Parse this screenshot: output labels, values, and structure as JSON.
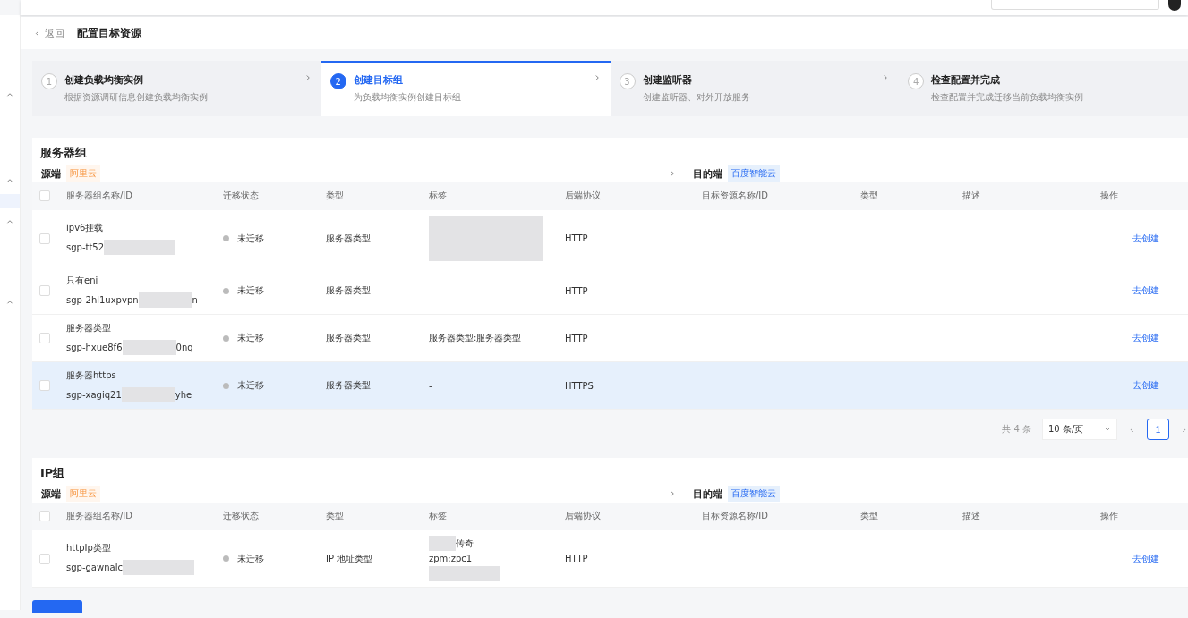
{
  "header": {
    "back": "返回",
    "title": "配置目标资源"
  },
  "steps": [
    {
      "number": "1",
      "title": "创建负载均衡实例",
      "desc": "根据资源调研信息创建负载均衡实例",
      "selected": false
    },
    {
      "number": "2",
      "title": "创建目标组",
      "desc": "为负载均衡实例创建目标组",
      "selected": true
    },
    {
      "number": "3",
      "title": "创建监听器",
      "desc": "创建监听器、对外开放服务",
      "selected": false
    },
    {
      "number": "4",
      "title": "检查配置并完成",
      "desc": "检查配置并完成迁移当前负载均衡实例",
      "selected": false
    }
  ],
  "sections": [
    {
      "title": "服务器组",
      "source_label": "源端",
      "source_tag": "阿里云",
      "target_label": "目的端",
      "target_tag": "百度智能云",
      "all_checked": false,
      "columns": [
        "服务器组名称/ID",
        "迁移状态",
        "类型",
        "标签",
        "后端协议",
        "目标资源名称/ID",
        "类型",
        "描述",
        "操作"
      ],
      "rows": [
        {
          "name": "ipv6挂载",
          "id_start": "sgp-tt52",
          "id_end": "",
          "status": "未迁移",
          "type": "服务器类型",
          "tag_lines": [],
          "tag_redacted": true,
          "protocol": "HTTP",
          "action": "去创建",
          "selected": false
        },
        {
          "name": "只有eni",
          "id_start": "sgp-2hl1uxpvpn",
          "id_end": "n",
          "status": "未迁移",
          "type": "服务器类型",
          "tag_lines": [
            "-"
          ],
          "tag_redacted": false,
          "protocol": "HTTP",
          "action": "去创建",
          "selected": false
        },
        {
          "name": "服务器类型",
          "id_start": "sgp-hxue8f6",
          "id_end": "0nq",
          "status": "未迁移",
          "type": "服务器类型",
          "tag_lines": [
            "服务器类型:服务器类型"
          ],
          "tag_redacted": false,
          "protocol": "HTTP",
          "action": "去创建",
          "selected": false
        },
        {
          "name": "服务器https",
          "id_start": "sgp-xagiq21",
          "id_end": "yhe",
          "status": "未迁移",
          "type": "服务器类型",
          "tag_lines": [
            "-"
          ],
          "tag_redacted": false,
          "protocol": "HTTPS",
          "action": "去创建",
          "selected": true
        }
      ],
      "pagination": {
        "total": "共 4 条",
        "page_size": "10 条/页",
        "pages": [
          {
            "label": "1",
            "selected": true
          }
        ]
      }
    },
    {
      "title": "IP组",
      "source_label": "源端",
      "source_tag": "阿里云",
      "target_label": "目的端",
      "target_tag": "百度智能云",
      "all_checked": false,
      "columns": [
        "服务器组名称/ID",
        "迁移状态",
        "类型",
        "标签",
        "后端协议",
        "目标资源名称/ID",
        "类型",
        "描述",
        "操作"
      ],
      "rows": [
        {
          "name": "httpIp类型",
          "id_start": "sgp-gawnalc",
          "id_end": "",
          "status": "未迁移",
          "type": "IP 地址类型",
          "tag_lines": [
            "传奇",
            "zpm:zpc1"
          ],
          "tag_redacted": true,
          "protocol": "HTTP",
          "action": "去创建",
          "selected": false
        }
      ]
    }
  ]
}
